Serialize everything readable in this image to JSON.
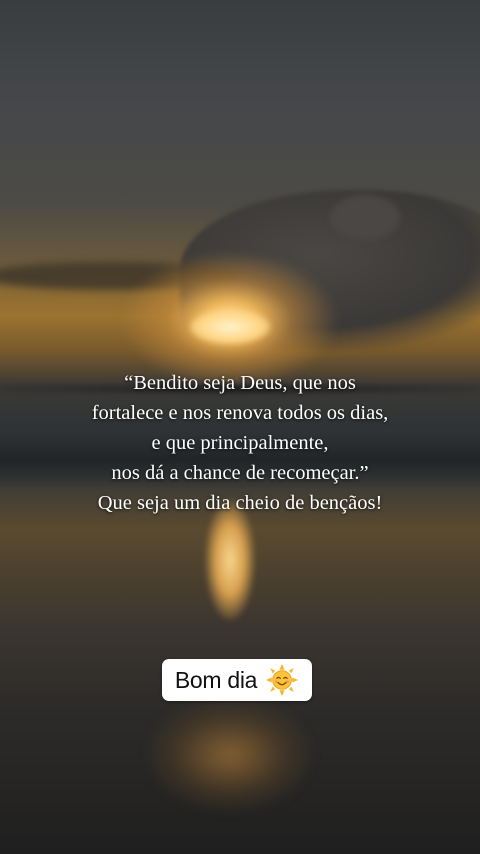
{
  "quote": {
    "lines": [
      "“Bendito seja Deus, que nos",
      "fortalece e nos renova todos os dias,",
      "e que principalmente,",
      "nos dá a chance de recomeçar.”",
      "Que seja um dia cheio de bençãos!"
    ]
  },
  "sticker": {
    "text": "Bom dia",
    "icon": "sun-with-face-icon"
  },
  "colors": {
    "text": "#ffffff",
    "sticker_bg": "#ffffff",
    "sticker_text": "#111111",
    "sun_face": "#f7b52c"
  }
}
